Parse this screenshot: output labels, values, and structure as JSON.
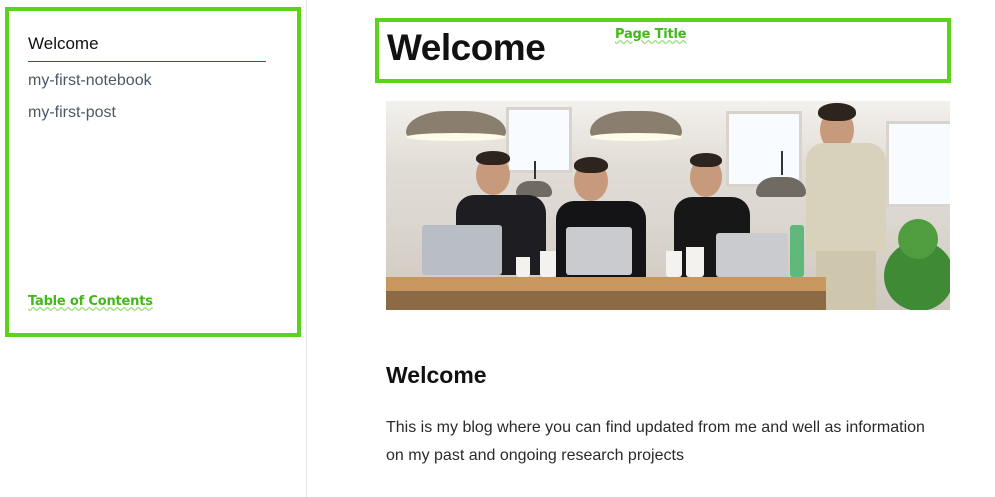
{
  "sidebar": {
    "active_item": "Welcome",
    "items": [
      {
        "label": "my-first-notebook"
      },
      {
        "label": "my-first-post"
      }
    ],
    "annotation_label": "Table of Contents"
  },
  "header": {
    "title": "Welcome",
    "annotation_label": "Page Title"
  },
  "main": {
    "section_heading": "Welcome",
    "paragraph": "This is my blog where you can find updated from me and well as information on my past and ongoing research projects"
  },
  "colors": {
    "annotation_green": "#5bd21c",
    "active_underline": "#1f5b86",
    "link_text": "#4a5866"
  }
}
